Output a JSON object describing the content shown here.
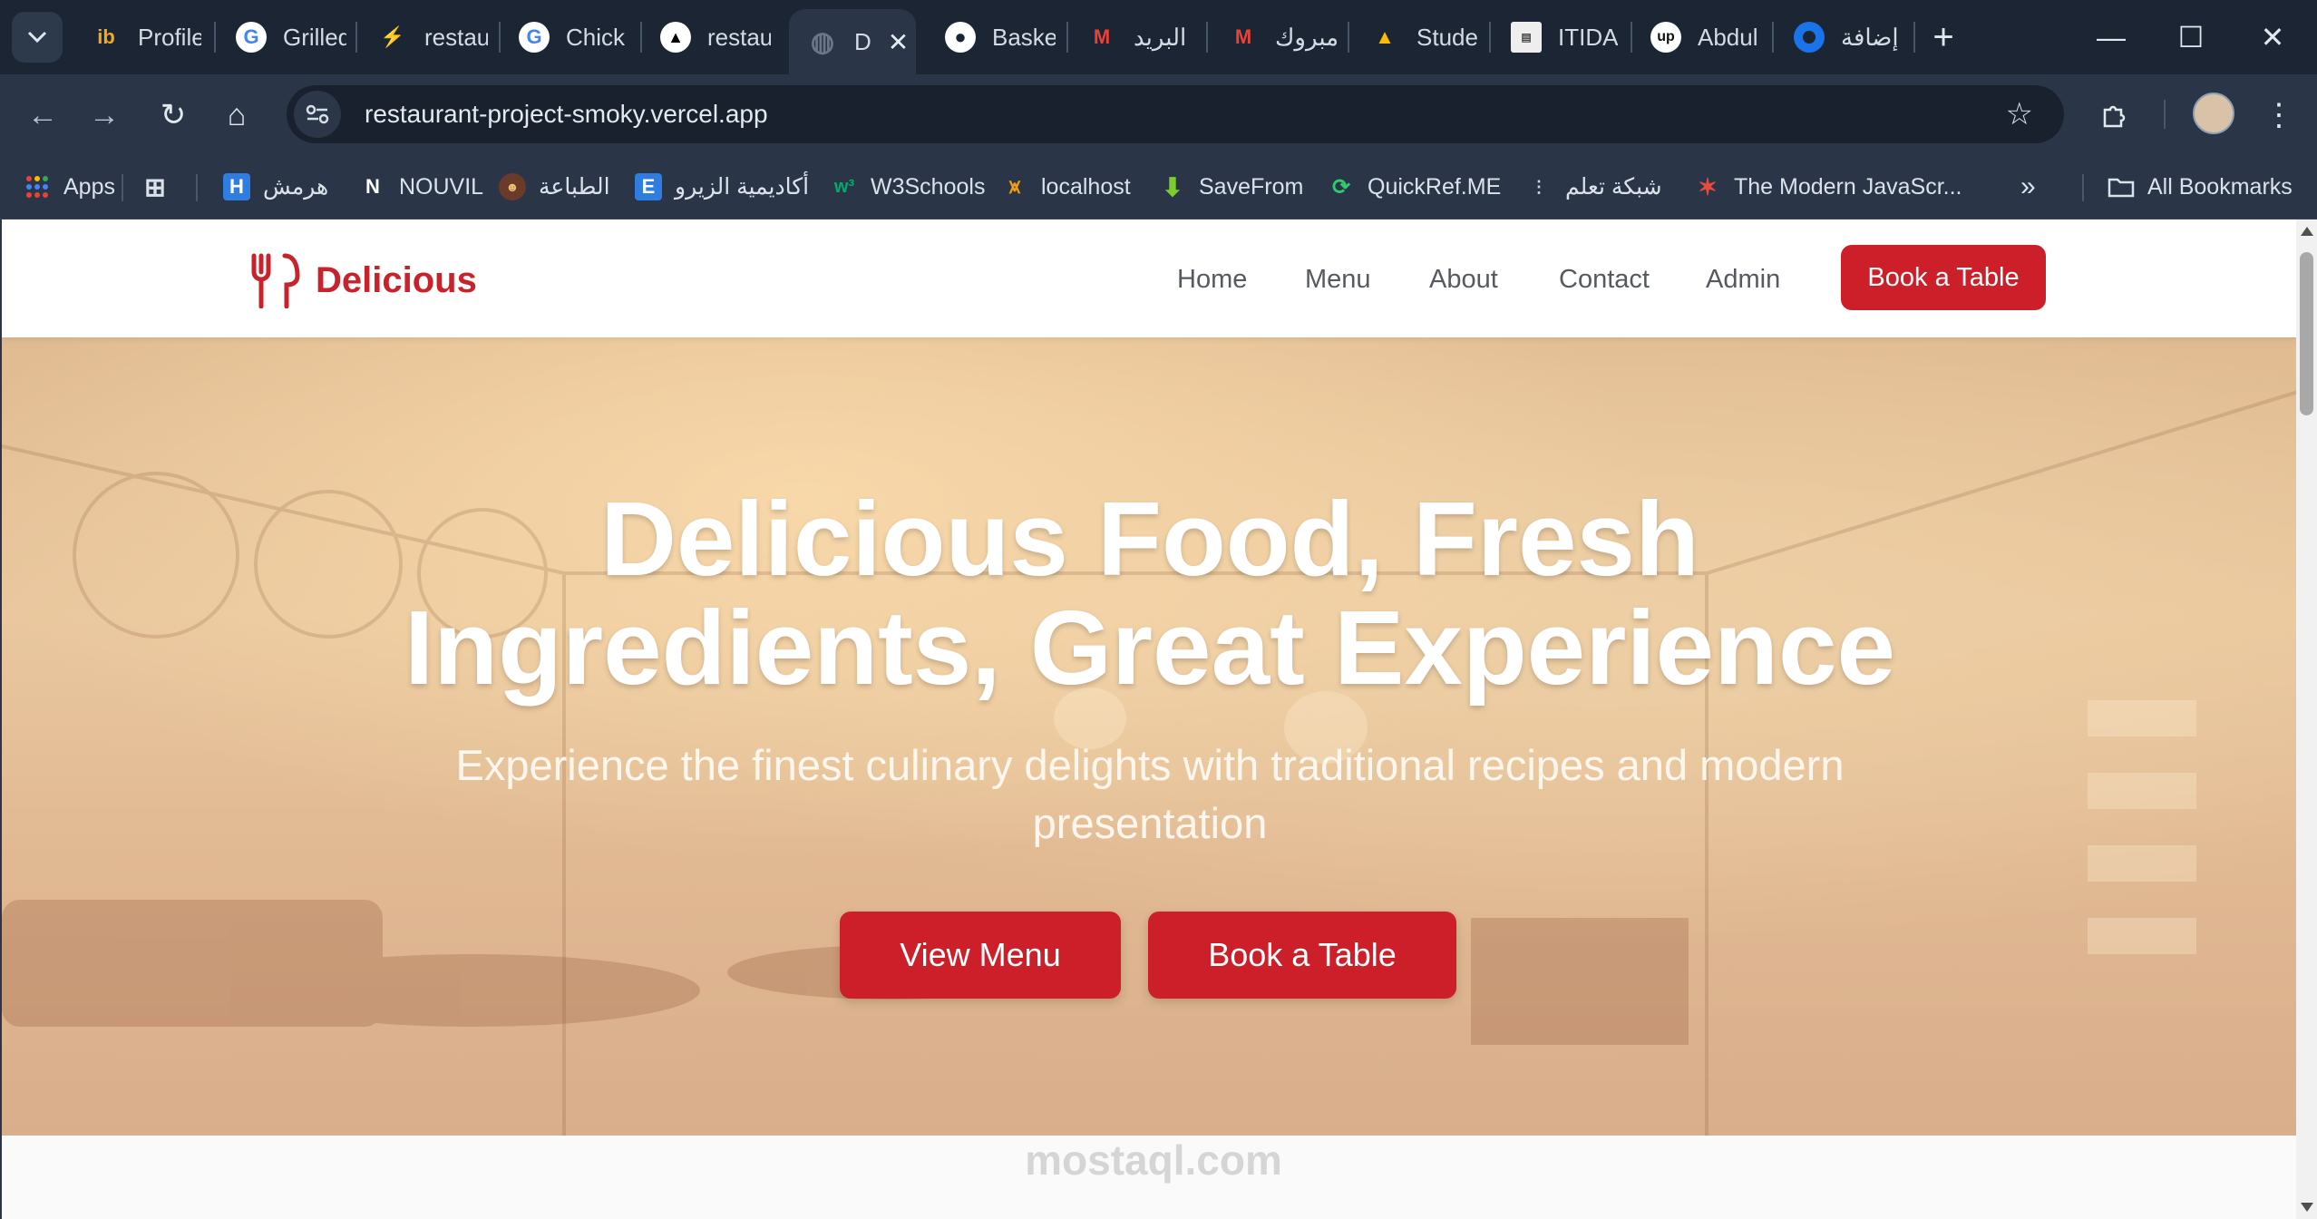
{
  "browser": {
    "tabs": [
      {
        "label": "Profile",
        "icon": "ib-icon",
        "color": "#f5a623"
      },
      {
        "label": "Grilled",
        "icon": "google-icon",
        "color": "#4285f4"
      },
      {
        "label": "restaurant",
        "icon": "bolt-icon",
        "color": "#22c55e"
      },
      {
        "label": "Chick",
        "icon": "google-icon",
        "color": "#4285f4"
      },
      {
        "label": "restau",
        "icon": "triangle-icon",
        "color": "#ffffff"
      },
      {
        "label": "D",
        "icon": "globe-icon",
        "color": "#6b7787",
        "active": true
      },
      {
        "label": "Baske",
        "icon": "github-icon",
        "color": "#ffffff"
      },
      {
        "label": "البريد",
        "icon": "gmail-icon",
        "color": "#ea4335"
      },
      {
        "label": "مبروك",
        "icon": "gmail-icon",
        "color": "#ea4335"
      },
      {
        "label": "Stude",
        "icon": "drive-icon",
        "color": "#fbbc04"
      },
      {
        "label": "ITIDA",
        "icon": "itida-icon",
        "color": "#dddddd"
      },
      {
        "label": "Abdul",
        "icon": "upwork-icon",
        "color": "#ffffff"
      },
      {
        "label": "إضافة",
        "icon": "circle-icon",
        "color": "#1a73e8"
      }
    ],
    "new_tab": "+",
    "window": {
      "minimize": "—",
      "maximize": "☐",
      "close": "✕"
    },
    "url": "restaurant-project-smoky.vercel.app",
    "bookmarks": [
      {
        "label": "Apps",
        "icon": "apps-icon"
      },
      {
        "label": "",
        "icon": "grid-icon"
      },
      {
        "label": "هرمش",
        "icon": "h-icon"
      },
      {
        "label": "NOUVIL",
        "icon": "n-icon"
      },
      {
        "label": "الطباعة",
        "icon": "avatar-icon"
      },
      {
        "label": "أكاديمية الزيرو",
        "icon": "e-icon"
      },
      {
        "label": "W3Schools",
        "icon": "w3-icon"
      },
      {
        "label": "localhost",
        "icon": "localhost-icon"
      },
      {
        "label": "SaveFrom",
        "icon": "download-icon"
      },
      {
        "label": "QuickRef.ME",
        "icon": "quickref-icon"
      },
      {
        "label": "شبكة تعلم",
        "icon": "network-icon"
      },
      {
        "label": "The Modern JavaScr...",
        "icon": "js-icon"
      }
    ],
    "more_bookmarks": "»",
    "all_bookmarks": "All Bookmarks"
  },
  "site": {
    "brand": "Delicious",
    "nav": [
      "Home",
      "Menu",
      "About",
      "Contact",
      "Admin"
    ],
    "cta": "Book a Table"
  },
  "hero": {
    "title_line1": "Delicious Food, Fresh",
    "title_line2": "Ingredients, Great Experience",
    "subtitle": "Experience the finest culinary delights with traditional recipes and modern presentation",
    "btn_menu": "View Menu",
    "btn_book": "Book a Table"
  },
  "watermark": "mostaql.com",
  "colors": {
    "brand_red": "#cd1f2a",
    "chrome_dark": "#1b2533",
    "toolbar": "#2a3647"
  }
}
